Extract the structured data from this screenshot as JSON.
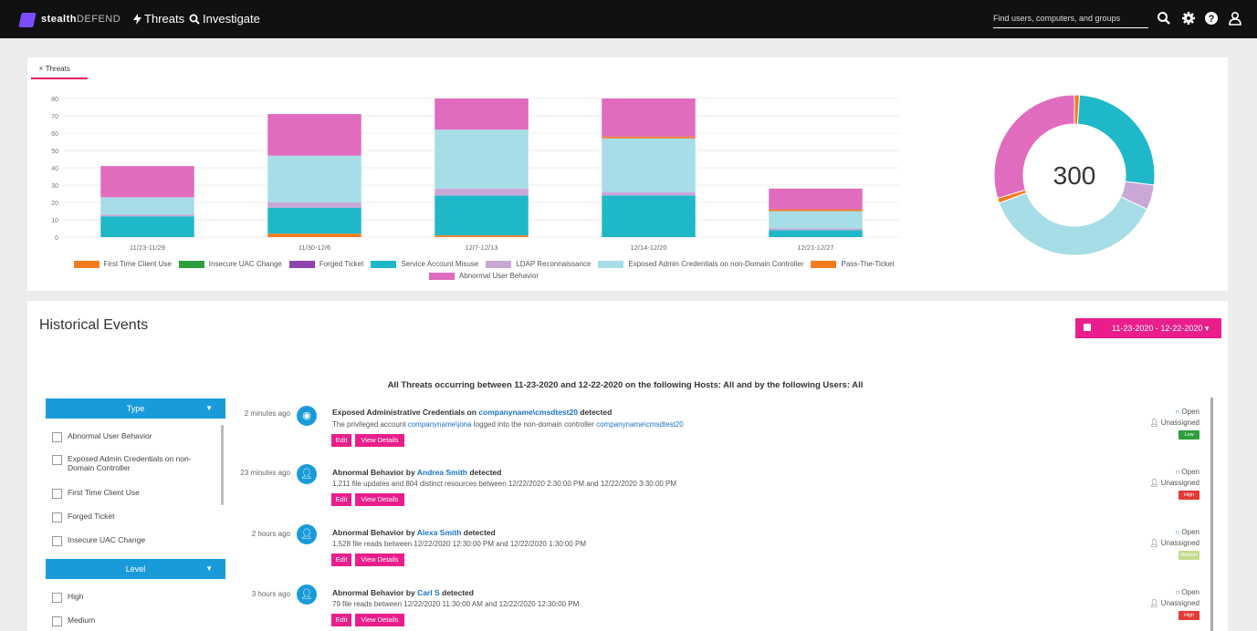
{
  "topbar": {
    "brand_bold": "stealth",
    "brand_light": "DEFEND",
    "nav_threats": "Threats",
    "nav_investigate": "Investigate",
    "search_placeholder": "Find users, computers, and groups"
  },
  "threats_tab": "Threats",
  "chart_data": {
    "type": "bar",
    "stacked": true,
    "categories": [
      "11/23-11/29",
      "11/30-12/6",
      "12/7-12/13",
      "12/14-12/20",
      "12/21-12/27"
    ],
    "ylim": [
      0,
      80
    ],
    "yticks": [
      0,
      10,
      20,
      30,
      40,
      50,
      60,
      70,
      80
    ],
    "grid": true,
    "series": [
      {
        "name": "First Time Client Use",
        "color": "#f57c20",
        "values": [
          0,
          2,
          1,
          0,
          0
        ]
      },
      {
        "name": "Insecure UAC Change",
        "color": "#2e9e3e",
        "values": [
          0,
          0,
          0,
          0,
          0
        ]
      },
      {
        "name": "Forged Ticket",
        "color": "#8e44ad",
        "values": [
          0,
          0,
          0,
          0,
          0
        ]
      },
      {
        "name": "Service Account Misuse",
        "color": "#1fb8c9",
        "values": [
          12,
          15,
          23,
          24,
          4
        ]
      },
      {
        "name": "LDAP Reconnaissance",
        "color": "#c9a8d8",
        "values": [
          1,
          3,
          4,
          2,
          1
        ]
      },
      {
        "name": "Exposed Admin Credentials on non-Domain Controller",
        "color": "#a6dde6",
        "values": [
          10,
          27,
          34,
          31,
          10
        ]
      },
      {
        "name": "Pass-The-Ticket",
        "color": "#f57c20",
        "values": [
          0,
          0,
          0,
          1,
          1
        ]
      },
      {
        "name": "Abnormal User Behavior",
        "color": "#e06bbf",
        "values": [
          18,
          24,
          18,
          22,
          12
        ]
      }
    ],
    "legend": "bottom",
    "donut": {
      "total_label": "300",
      "slices": [
        {
          "name": "First Time Client Use",
          "color": "#f57c20",
          "value": 3
        },
        {
          "name": "Service Account Misuse",
          "color": "#1fb8c9",
          "value": 78
        },
        {
          "name": "LDAP Reconnaissance",
          "color": "#c9a8d8",
          "value": 15
        },
        {
          "name": "Exposed Admin Credentials on non-Domain Controller",
          "color": "#a6dde6",
          "value": 112
        },
        {
          "name": "Pass-The-Ticket",
          "color": "#f57c20",
          "value": 3
        },
        {
          "name": "Abnormal User Behavior",
          "color": "#e06bbf",
          "value": 89
        }
      ]
    }
  },
  "historical": {
    "title": "Historical Events",
    "date_range": "11-23-2020 - 12-22-2020 ▾",
    "summary": "All Threats occurring between 11-23-2020 and 12-22-2020 on the following Hosts: All and by the following Users: All"
  },
  "filters": {
    "type_label": "Type",
    "type_items": [
      "Abnormal User Behavior",
      "Exposed Admin Credentials on non-Domain Controller",
      "First Time Client Use",
      "Forged Ticket",
      "Insecure UAC Change"
    ],
    "level_label": "Level",
    "level_items": [
      "High",
      "Medium"
    ]
  },
  "events": [
    {
      "time": "2 minutes ago",
      "title_pre": "Exposed Administrative Credentials on ",
      "title_link": "companyname\\cmsdtest20",
      "title_post": " detected",
      "desc_pre": "The privileged account ",
      "desc_link1": "companyname\\jona",
      "desc_mid": " logged into the non-domain controller ",
      "desc_link2": "companyname\\cmsdtest20",
      "desc_post": "",
      "status": "Open",
      "assignee": "Unassigned",
      "severity": "Low",
      "severity_color": "#2e9e3e"
    },
    {
      "time": "23 minutes ago",
      "title_pre": "Abnormal Behavior by ",
      "title_link": "Andrea Smith",
      "title_post": " detected",
      "desc_pre": "1,211 file updates and 804 distinct resources between 12/22/2020 2:30:00 PM and 12/22/2020 3:30:00 PM",
      "desc_link1": "",
      "desc_mid": "",
      "desc_link2": "",
      "desc_post": "",
      "status": "Open",
      "assignee": "Unassigned",
      "severity": "High",
      "severity_color": "#e53935"
    },
    {
      "time": "2 hours ago",
      "title_pre": "Abnormal Behavior by ",
      "title_link": "Alexa Smith",
      "title_post": " detected",
      "desc_pre": "1,528 file reads between 12/22/2020 12:30:00 PM and 12/22/2020 1:30:00 PM",
      "desc_link1": "",
      "desc_mid": "",
      "desc_link2": "",
      "desc_post": "",
      "status": "Open",
      "assignee": "Unassigned",
      "severity": "Medium",
      "severity_color": "#c6db8c"
    },
    {
      "time": "3 hours ago",
      "title_pre": "Abnormal Behavior by ",
      "title_link": "Carl S",
      "title_post": " detected",
      "desc_pre": "79 file reads between 12/22/2020 11:30:00 AM and 12/22/2020 12:30:00 PM",
      "desc_link1": "",
      "desc_mid": "",
      "desc_link2": "",
      "desc_post": "",
      "status": "Open",
      "assignee": "Unassigned",
      "severity": "High",
      "severity_color": "#e53935"
    }
  ],
  "buttons": {
    "edit": "Edit",
    "view_details": "View Details"
  }
}
